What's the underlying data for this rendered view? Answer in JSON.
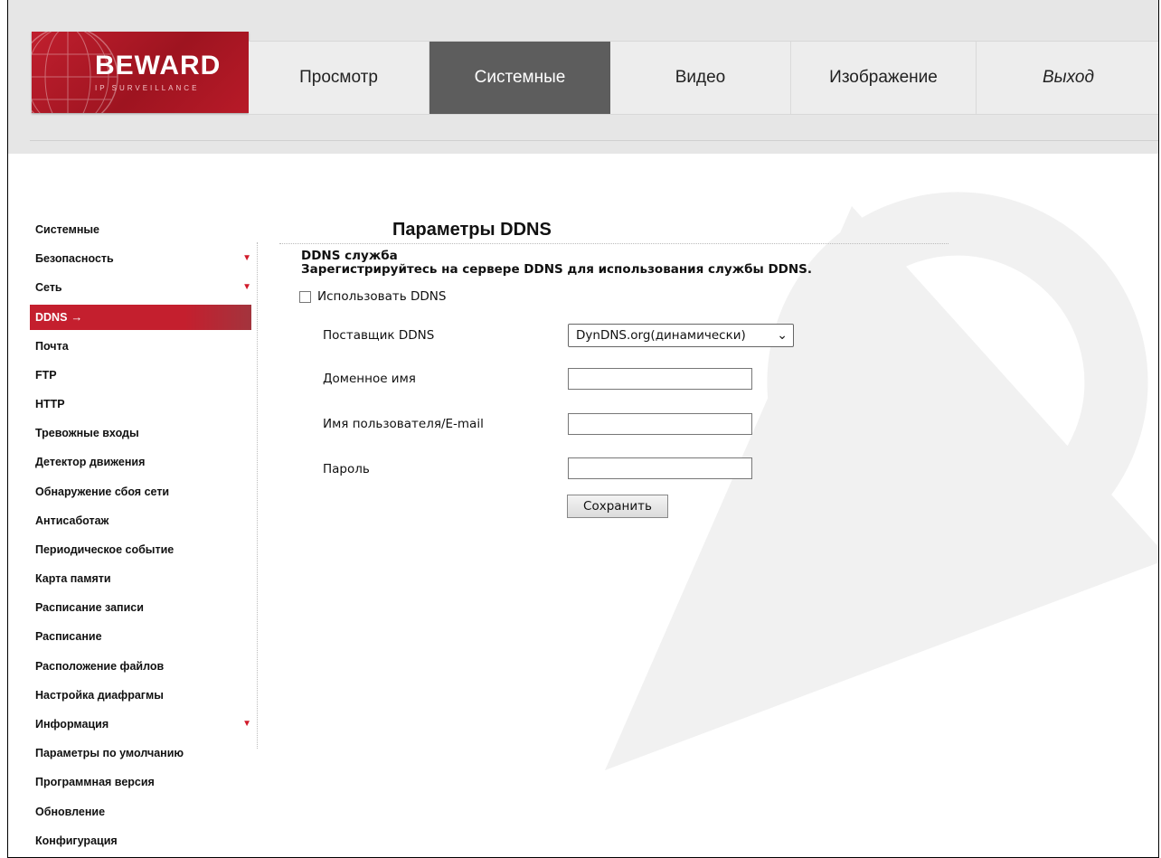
{
  "logo": {
    "brand": "BEWARD",
    "sub": "IP SURVEILLANCE"
  },
  "nav": {
    "items": [
      {
        "label": "Просмотр"
      },
      {
        "label": "Системные"
      },
      {
        "label": "Видео"
      },
      {
        "label": "Изображение"
      },
      {
        "label": "Выход"
      }
    ]
  },
  "sidebar": {
    "items": [
      {
        "label": "Системные"
      },
      {
        "label": "Безопасность"
      },
      {
        "label": "Сеть"
      },
      {
        "label": "DDNS"
      },
      {
        "label": "Почта"
      },
      {
        "label": "FTP"
      },
      {
        "label": "HTTP"
      },
      {
        "label": "Тревожные входы"
      },
      {
        "label": "Детектор движения"
      },
      {
        "label": "Обнаружение сбоя сети"
      },
      {
        "label": "Антисаботаж"
      },
      {
        "label": "Периодическое событие"
      },
      {
        "label": "Карта памяти"
      },
      {
        "label": "Расписание записи"
      },
      {
        "label": "Расписание"
      },
      {
        "label": "Расположение файлов"
      },
      {
        "label": "Настройка диафрагмы"
      },
      {
        "label": "Информация"
      },
      {
        "label": "Параметры по умолчанию"
      },
      {
        "label": "Программная версия"
      },
      {
        "label": "Обновление"
      },
      {
        "label": "Конфигурация"
      }
    ]
  },
  "main": {
    "title": "Параметры DDNS",
    "section_title": "DDNS служба",
    "section_desc": "Зарегистрируйтесь на сервере DDNS для использования службы DDNS.",
    "use_ddns_label": "Использовать DDNS",
    "use_ddns_checked": false,
    "provider_label": "Поставщик DDNS",
    "provider_value": "DynDNS.org(динамически)",
    "domain_label": "Доменное имя",
    "domain_value": "",
    "user_label": "Имя пользователя/E-mail",
    "user_value": "",
    "password_label": "Пароль",
    "password_value": "",
    "save_label": "Сохранить"
  },
  "colors": {
    "accent": "#c41f2e",
    "nav_active": "#5d5d5d",
    "header_bg": "#e6e6e6"
  }
}
